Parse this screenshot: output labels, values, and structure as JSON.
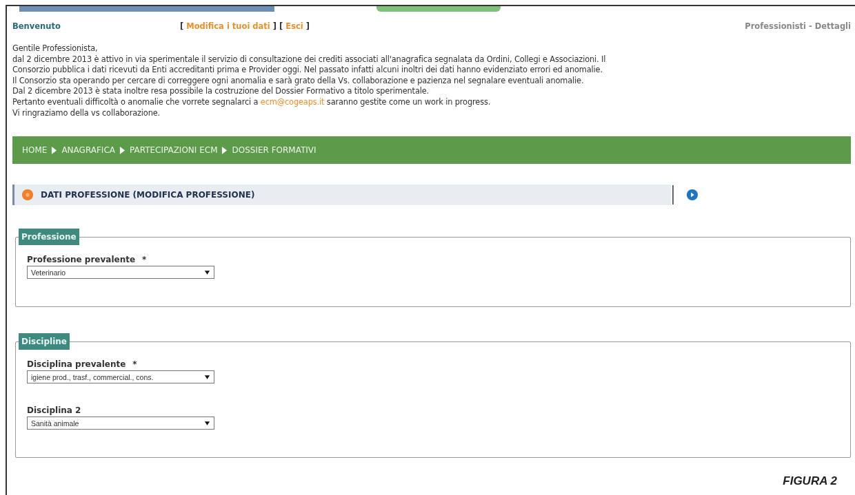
{
  "header": {
    "welcome": "Benvenuto",
    "links_open": "[",
    "edit_link": "Modifica i tuoi dati",
    "links_mid": "] [",
    "logout_link": "Esci",
    "links_close": "]",
    "page_title": "Professionisti - Dettagli"
  },
  "intro": {
    "lines": [
      "Gentile Professionista,",
      "dal 2 dicembre 2013 è attivo in via sperimentale il servizio di consultazione dei crediti associati all'anagrafica segnalata da Ordini, Collegi e Associazioni. Il",
      "Consorzio pubblica i dati ricevuti da Enti accreditanti prima e Provider oggi. Nel passato infatti alcuni inoltri dei dati hanno evidenziato errori ed anomalie.",
      "Il Consorzio sta operando per cercare di correggere ogni anomalia e sarà grato della Vs. collaborazione e pazienza nel segnalare eventuali anomalie.",
      "Dal 2 dicembre 2013 è stata inoltre resa possibile la costruzione del Dossier Formativo a titolo sperimentale."
    ],
    "link_line": {
      "before": "Pertanto eventuali difficoltà o anomalie che vorrete segnalarci a ",
      "email": "ecm@cogeaps.it",
      "after": " saranno gestite come un work in progress."
    },
    "closing": "Vi ringraziamo della vs collaborazione."
  },
  "breadcrumb": [
    {
      "label": "HOME"
    },
    {
      "label": "ANAGRAFICA"
    },
    {
      "label": "PARTECIPAZIONI ECM"
    },
    {
      "label": "DOSSIER FORMATIVI"
    }
  ],
  "section": {
    "title": "DATI PROFESSIONE (MODIFICA PROFESSIONE)"
  },
  "fieldsets": [
    {
      "legend": "Professione",
      "fields": [
        {
          "label": "Professione prevalente",
          "required_mark": "*",
          "value": "Veterinario"
        }
      ]
    },
    {
      "legend": "Discipline",
      "fields": [
        {
          "label": "Disciplina prevalente",
          "required_mark": "*",
          "value": "igiene prod., trasf., commercial., cons."
        },
        {
          "label": "Disciplina 2",
          "value": "Sanità animale"
        }
      ]
    }
  ],
  "caption": "FIGURA 2"
}
